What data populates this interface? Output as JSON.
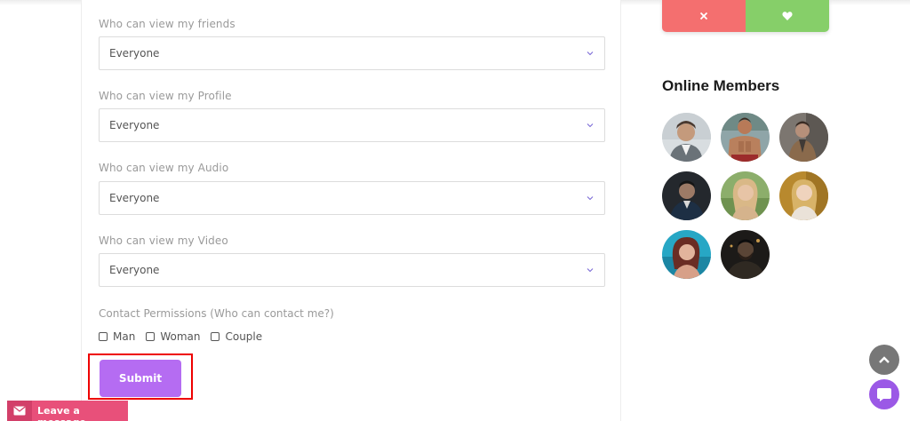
{
  "privacy_form": {
    "fields": [
      {
        "label": "Who can view my friends",
        "value": "Everyone"
      },
      {
        "label": "Who can view my Profile",
        "value": "Everyone"
      },
      {
        "label": "Who can view my Audio",
        "value": "Everyone"
      },
      {
        "label": "Who can view my Video",
        "value": "Everyone"
      }
    ],
    "contact_permissions": {
      "label": "Contact Permissions (Who can contact me?)",
      "options": [
        {
          "label": "Man",
          "checked": false
        },
        {
          "label": "Woman",
          "checked": false
        },
        {
          "label": "Couple",
          "checked": false
        }
      ]
    },
    "submit_label": "Submit"
  },
  "sidebar": {
    "actions": {
      "reject_icon": "close-icon",
      "like_icon": "heart-icon",
      "reject_color": "#f46f6f",
      "like_color": "#86cf69"
    },
    "online_members": {
      "title": "Online Members",
      "members": [
        {
          "icon": "avatar"
        },
        {
          "icon": "avatar"
        },
        {
          "icon": "avatar"
        },
        {
          "icon": "avatar"
        },
        {
          "icon": "avatar"
        },
        {
          "icon": "avatar"
        },
        {
          "icon": "avatar"
        },
        {
          "icon": "avatar"
        }
      ]
    }
  },
  "widgets": {
    "leave_message": "Leave a message",
    "scroll_top_icon": "chevron-up-icon",
    "chat_icon": "chat-bubble-icon"
  },
  "colors": {
    "accent": "#b56cf2",
    "highlight_border": "#ee0000",
    "leave_message_bg": "#e8507a",
    "chat_button": "#9b59e6"
  }
}
